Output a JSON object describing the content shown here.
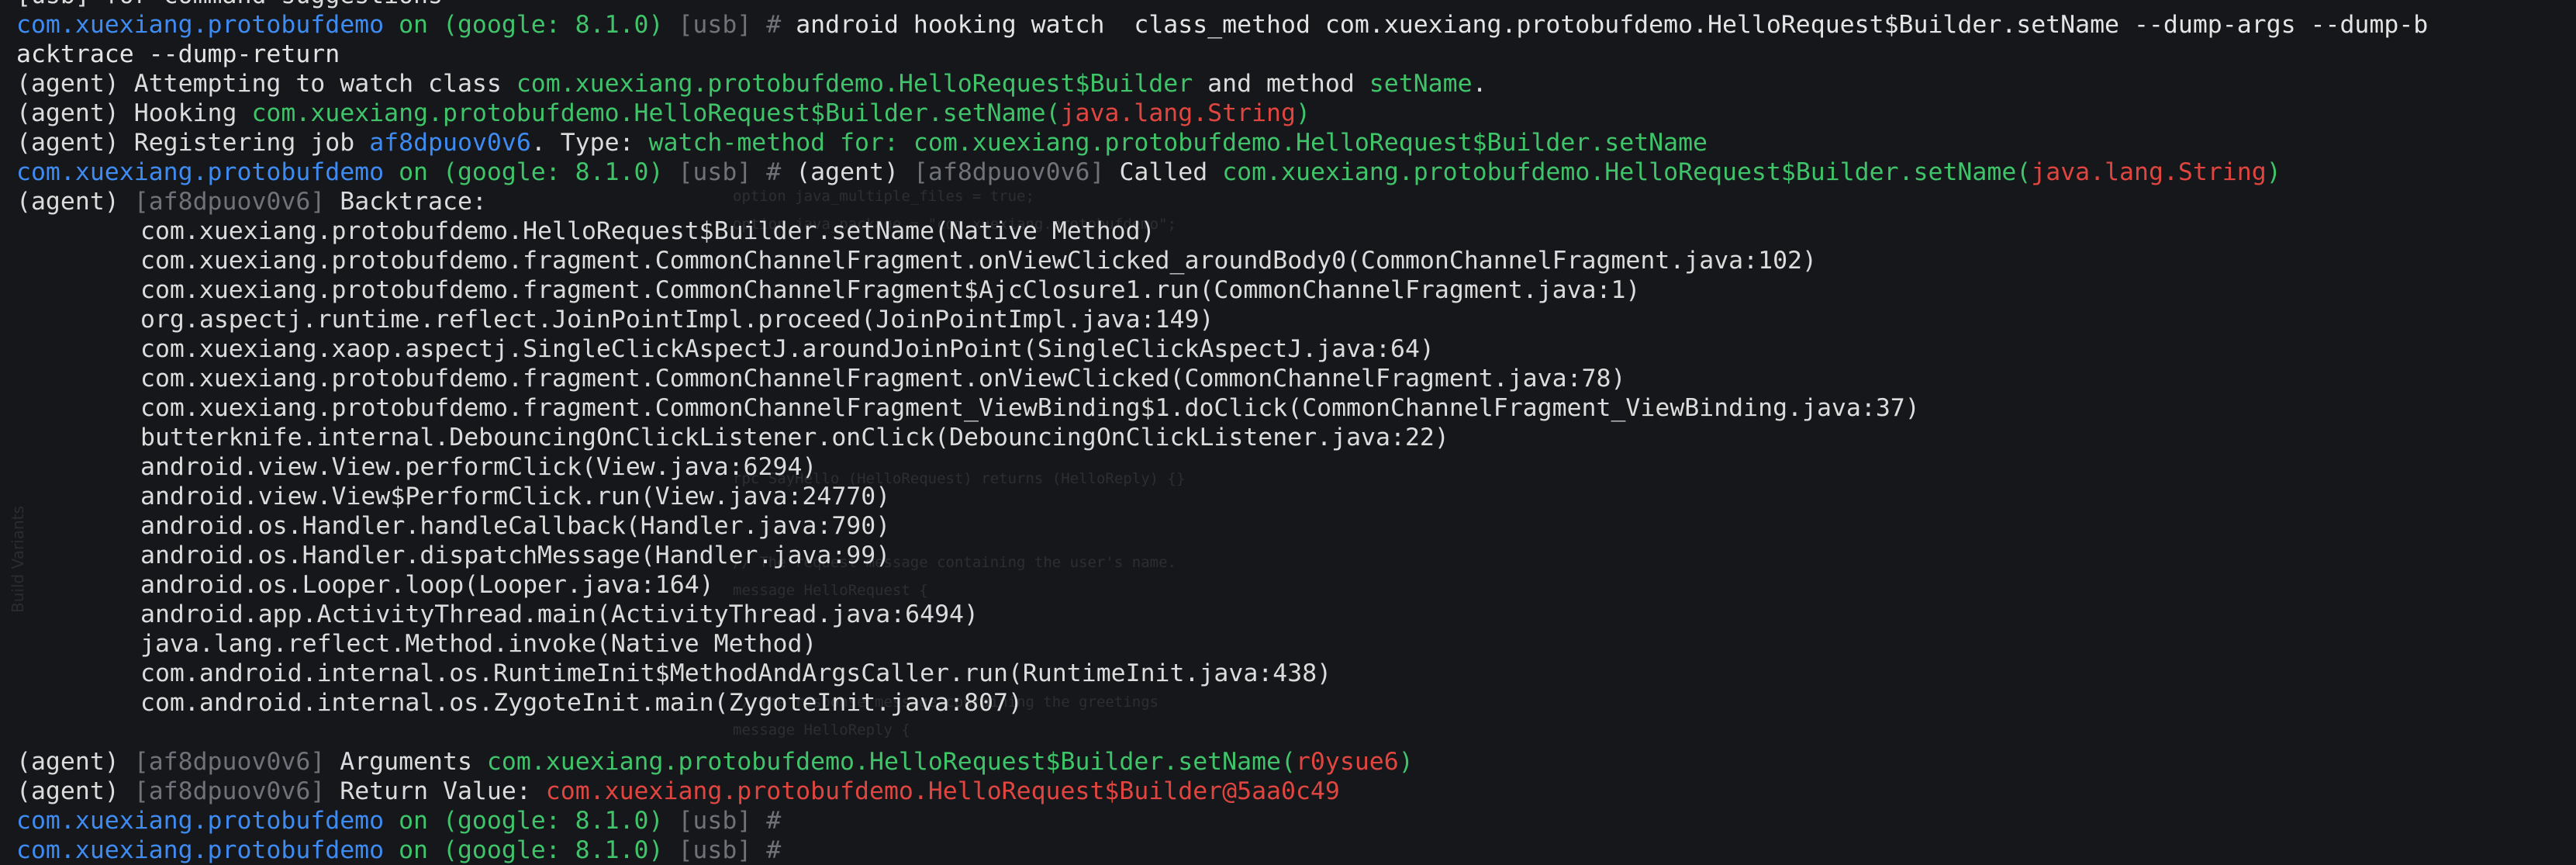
{
  "terminal": {
    "top_partial": {
      "prompt": "[usb]",
      "text": "for command suggestions"
    },
    "prompt": {
      "package": "com.xuexiang.protobufdemo",
      "on": "on",
      "device": "(google: 8.1.0)",
      "conn": "[usb]",
      "hash": "#"
    },
    "command": "android hooking watch  class_method com.xuexiang.protobufdemo.HelloRequest$Builder.setName --dump-args --dump-b",
    "command_wrap": "acktrace --dump-return",
    "agent": "(agent)",
    "msg1": {
      "pre": "Attempting to watch class",
      "cls": "com.xuexiang.protobufdemo.HelloRequest$Builder",
      "mid": "and method",
      "method": "setName",
      "end": "."
    },
    "msg2": {
      "pre": "Hooking",
      "target": "com.xuexiang.protobufdemo.HelloRequest$Builder.setName(",
      "arg": "java.lang.String",
      "close": ")"
    },
    "msg3": {
      "pre": "Registering job",
      "job": "af8dpuov0v6",
      "mid": ". Type:",
      "type": "watch-method for: com.xuexiang.protobufdemo.HelloRequest$Builder.setName"
    },
    "job_tag": "[af8dpuov0v6]",
    "called": {
      "pre": "Called",
      "target": "com.xuexiang.protobufdemo.HelloRequest$Builder.setName(",
      "arg": "java.lang.String",
      "close": ")"
    },
    "backtrace_label": "Backtrace:",
    "backtrace": [
      "com.xuexiang.protobufdemo.HelloRequest$Builder.setName(Native Method)",
      "com.xuexiang.protobufdemo.fragment.CommonChannelFragment.onViewClicked_aroundBody0(CommonChannelFragment.java:102)",
      "com.xuexiang.protobufdemo.fragment.CommonChannelFragment$AjcClosure1.run(CommonChannelFragment.java:1)",
      "org.aspectj.runtime.reflect.JoinPointImpl.proceed(JoinPointImpl.java:149)",
      "com.xuexiang.xaop.aspectj.SingleClickAspectJ.aroundJoinPoint(SingleClickAspectJ.java:64)",
      "com.xuexiang.protobufdemo.fragment.CommonChannelFragment.onViewClicked(CommonChannelFragment.java:78)",
      "com.xuexiang.protobufdemo.fragment.CommonChannelFragment_ViewBinding$1.doClick(CommonChannelFragment_ViewBinding.java:37)",
      "butterknife.internal.DebouncingOnClickListener.onClick(DebouncingOnClickListener.java:22)",
      "android.view.View.performClick(View.java:6294)",
      "android.view.View$PerformClick.run(View.java:24770)",
      "android.os.Handler.handleCallback(Handler.java:790)",
      "android.os.Handler.dispatchMessage(Handler.java:99)",
      "android.os.Looper.loop(Looper.java:164)",
      "android.app.ActivityThread.main(ActivityThread.java:6494)",
      "java.lang.reflect.Method.invoke(Native Method)",
      "com.android.internal.os.RuntimeInit$MethodAndArgsCaller.run(RuntimeInit.java:438)",
      "com.android.internal.os.ZygoteInit.main(ZygoteInit.java:807)"
    ],
    "arguments": {
      "pre": "Arguments",
      "target": "com.xuexiang.protobufdemo.HelloRequest$Builder.setName(",
      "value": "r0ysue6",
      "close": ")"
    },
    "return": {
      "pre": "Return Value:",
      "value": "com.xuexiang.protobufdemo.HelloRequest$Builder@5aa0c49"
    }
  },
  "background_ghost": [
    "option java_multiple_files = true;",
    "option java_package = \"com.xuexiang.protobufdemo\";",
    "rpc SayHello (HelloRequest) returns (HelloReply) {}",
    "// The request message containing the user's name.",
    "message HelloRequest {",
    "// The response message containing the greetings",
    "message HelloReply {"
  ],
  "side_ghost": "Build Variants",
  "colors": {
    "background": "#16171b",
    "package_blue": "#3e8bf2",
    "on_green": "#3fc46a",
    "grey": "#6f7278",
    "red": "#e0463f",
    "text": "#dcdcdc"
  }
}
